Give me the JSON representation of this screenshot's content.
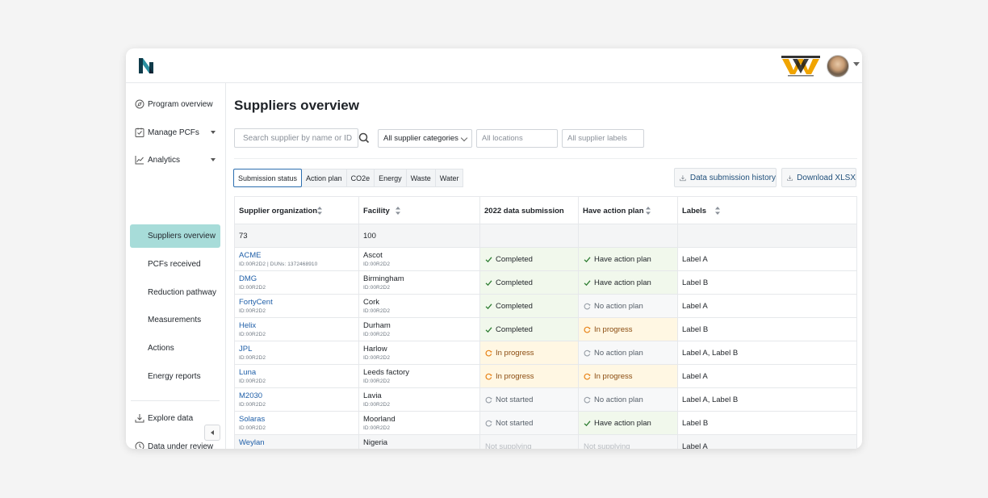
{
  "colors": {
    "accent": "#1f5fa8",
    "active_nav": "#a7dcd9",
    "completed_bg": "#f1f8ec",
    "completed_icon": "#2e7d32",
    "progress_bg": "#fff7e3",
    "progress_icon": "#e8851c",
    "none_icon": "#9aa1a9"
  },
  "header": {
    "brand_icon": "app-logo",
    "corp_logo": "weyland-yutani-logo",
    "avatar": "user-avatar"
  },
  "sidebar": {
    "items": [
      {
        "label": "Program overview",
        "icon": "compass-icon"
      },
      {
        "label": "Manage PCFs",
        "icon": "checklist-icon"
      },
      {
        "label": "Analytics",
        "icon": "chart-icon"
      },
      {
        "label": "Suppliers overview"
      },
      {
        "label": "PCFs received"
      },
      {
        "label": "Reduction pathway"
      },
      {
        "label": "Measurements"
      },
      {
        "label": "Actions"
      },
      {
        "label": "Energy reports"
      }
    ],
    "secondary": [
      {
        "label": "Explore data",
        "icon": "download-icon"
      },
      {
        "label": "Data under review",
        "icon": "clock-icon"
      }
    ]
  },
  "main": {
    "title": "Suppliers overview",
    "search_placeholder": "Search supplier by name or ID",
    "filters": {
      "categories": "All supplier categories",
      "locations": "All locations",
      "labels": "All supplier labels"
    },
    "tabs": [
      "Submission status",
      "Action plan",
      "CO2e",
      "Energy",
      "Waste",
      "Water"
    ],
    "actions": {
      "history": "Data submission history",
      "download": "Download XLSX"
    }
  },
  "table": {
    "columns": [
      "Supplier organization",
      "Facility",
      "2022 data submission",
      "Have action plan",
      "Labels"
    ],
    "summary": {
      "suppliers": "73",
      "facilities": "100"
    },
    "rows": [
      {
        "supplier": "ACME",
        "id": "ID:00R2D2  |  DUNs: 1372468910",
        "facility": "Ascot",
        "facility_id": "ID:00R2D2",
        "submission": "Completed",
        "plan": "Have action plan",
        "labels": "Label A"
      },
      {
        "supplier": "DMG",
        "id": "ID:00R2D2",
        "facility": "Birmingham",
        "facility_id": "ID:00R2D2",
        "submission": "Completed",
        "plan": "Have action plan",
        "labels": "Label B"
      },
      {
        "supplier": "FortyCent",
        "id": "ID:00R2D2",
        "facility": "Cork",
        "facility_id": "ID:00R2D2",
        "submission": "Completed",
        "plan": "No action plan",
        "labels": "Label A"
      },
      {
        "supplier": "Helix",
        "id": "ID:00R2D2",
        "facility": "Durham",
        "facility_id": "ID:00R2D2",
        "submission": "Completed",
        "plan": "In progress",
        "labels": "Label B"
      },
      {
        "supplier": "JPL",
        "id": "ID:00R2D2",
        "facility": "Harlow",
        "facility_id": "ID:00R2D2",
        "submission": "In progress",
        "plan": "No action plan",
        "labels": "Label A, Label B"
      },
      {
        "supplier": "Luna",
        "id": "ID:00R2D2",
        "facility": "Leeds factory",
        "facility_id": "ID:00R2D2",
        "submission": "In progress",
        "plan": "In progress",
        "labels": "Label A"
      },
      {
        "supplier": "M2030",
        "id": "ID:00R2D2",
        "facility": "Lavia",
        "facility_id": "ID:00R2D2",
        "submission": "Not started",
        "plan": "No action plan",
        "labels": "Label A, Label B"
      },
      {
        "supplier": "Solaras",
        "id": "ID:00R2D2",
        "facility": "Moorland",
        "facility_id": "ID:00R2D2",
        "submission": "Not started",
        "plan": "Have action plan",
        "labels": "Label B"
      },
      {
        "supplier": "Weylan",
        "id": "",
        "facility": "Nigeria",
        "facility_id": "",
        "submission": "Not supplying",
        "plan": "Not supplying",
        "labels": "Label A"
      }
    ]
  }
}
